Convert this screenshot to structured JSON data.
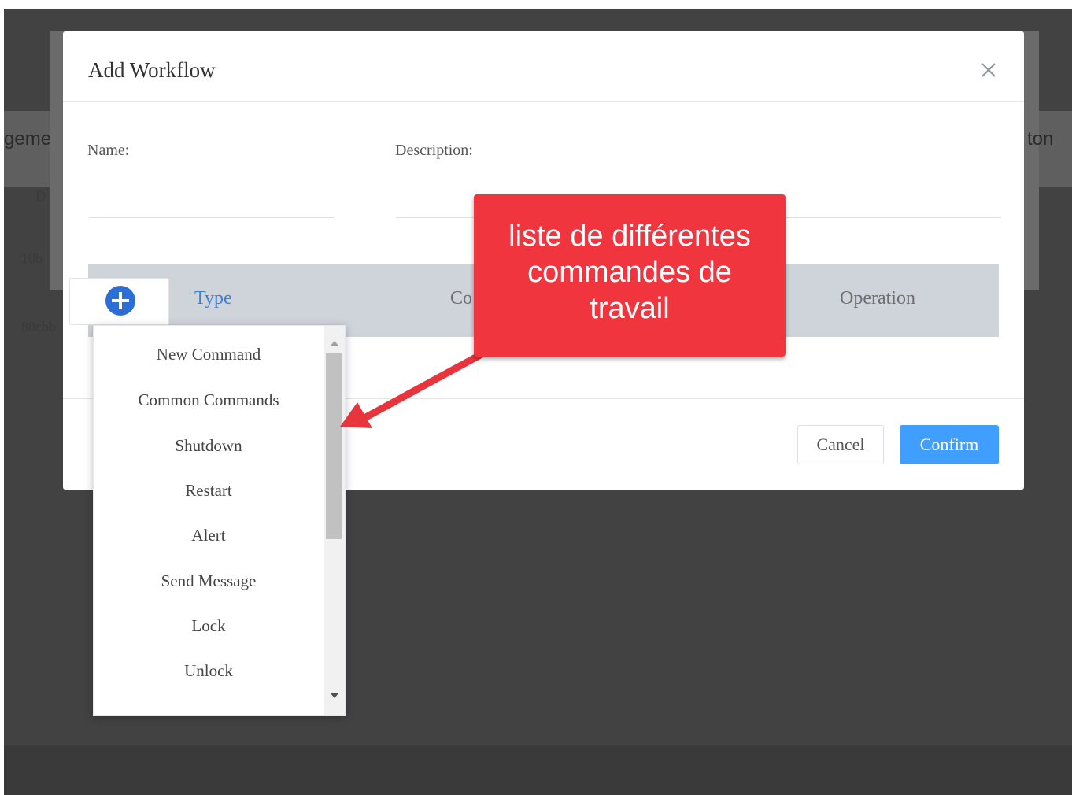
{
  "background": {
    "left_text_1": "geme",
    "right_text_1": "ton",
    "left_text_2": "D",
    "left_text_3": "10b",
    "left_text_4": "80cbb"
  },
  "dialog": {
    "title": "Add Workflow",
    "close_icon": "close-icon",
    "name_label": "Name:",
    "name_value": "",
    "description_label": "Description:",
    "description_value": "",
    "table": {
      "add_icon": "plus-circle-icon",
      "columns": [
        "Type",
        "Co",
        "Operation"
      ]
    },
    "cancel_label": "Cancel",
    "confirm_label": "Confirm"
  },
  "dropdown": {
    "items": [
      "New Command",
      "Common Commands",
      "Shutdown",
      "Restart",
      "Alert",
      "Send Message",
      "Lock",
      "Unlock"
    ]
  },
  "callout": {
    "text": "liste de différentes\ncommandes de\ntravail"
  },
  "colors": {
    "overlay": "#424242",
    "primary": "#409eff",
    "callout": "#f0353f",
    "add_icon": "#2b6fd6"
  }
}
